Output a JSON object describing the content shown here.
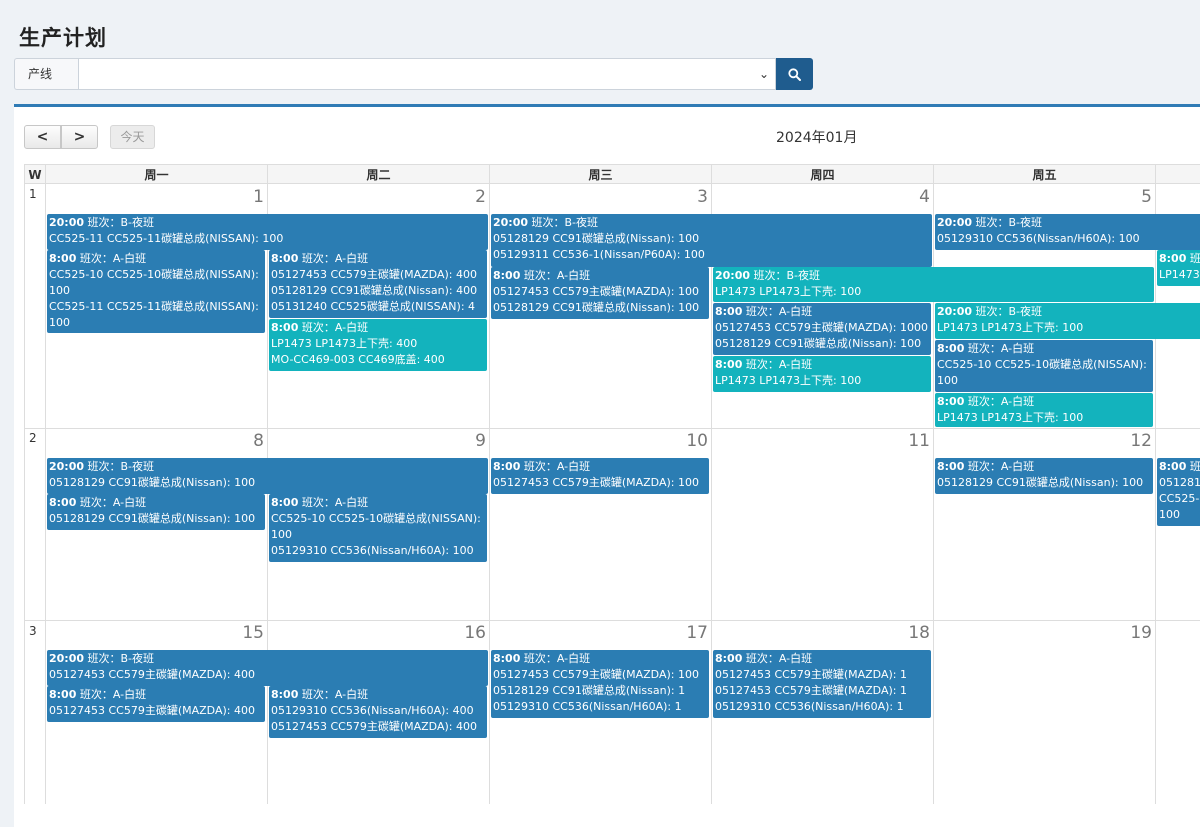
{
  "page": {
    "title": "生产计划"
  },
  "filter": {
    "label": "产线",
    "value": ""
  },
  "toolbar": {
    "prev": "<",
    "next": ">",
    "today": "今天",
    "month": "2024年01月"
  },
  "weekdays": [
    "W",
    "周一",
    "周二",
    "周三",
    "周四",
    "周五"
  ],
  "weeks": [
    {
      "week": "1",
      "days": [
        "1",
        "2",
        "3",
        "4",
        "5"
      ]
    },
    {
      "week": "2",
      "days": [
        "8",
        "9",
        "10",
        "11",
        "12"
      ]
    },
    {
      "week": "3",
      "days": [
        "15",
        "16",
        "17",
        "18",
        "19"
      ]
    }
  ],
  "events": [
    {
      "time": "20:00",
      "shift": " 班次：B-夜班",
      "color": "blue",
      "lines": [
        "CC525-11 CC525-11碳罐总成(NISSAN): 100"
      ]
    },
    {
      "time": "20:00",
      "shift": " 班次：B-夜班",
      "color": "blue",
      "lines": [
        "05128129 CC91碳罐总成(Nissan): 100",
        "05129311 CC536-1(Nissan/P60A): 100"
      ]
    },
    {
      "time": "20:00",
      "shift": " 班次：B-夜班",
      "color": "blue",
      "lines": [
        "05129310 CC536(Nissan/H60A): 100"
      ]
    },
    {
      "time": "8:00",
      "shift": " 班次：A-白班",
      "color": "blue",
      "lines": [
        "CC525-10 CC525-10碳罐总成(NISSAN):",
        "100",
        "CC525-11 CC525-11碳罐总成(NISSAN):",
        "100"
      ]
    },
    {
      "time": "8:00",
      "shift": " 班次：A-白班",
      "color": "blue",
      "lines": [
        "05127453 CC579主碳罐(MAZDA): 400",
        "05128129 CC91碳罐总成(Nissan): 400",
        "05131240 CC525碳罐总成(NISSAN): 4"
      ]
    },
    {
      "time": "8:00",
      "shift": " 班次：A-白班",
      "color": "blue",
      "lines": [
        "05127453 CC579主碳罐(MAZDA): 100",
        "05128129 CC91碳罐总成(Nissan): 100"
      ]
    },
    {
      "time": "20:00",
      "shift": " 班次：B-夜班",
      "color": "teal",
      "lines": [
        "LP1473 LP1473上下壳: 100"
      ]
    },
    {
      "time": "8:00",
      "shift": " 班次",
      "color": "teal",
      "lines": [
        "LP1473"
      ]
    },
    {
      "time": "8:00",
      "shift": " 班次：A-白班",
      "color": "teal",
      "lines": [
        "LP1473 LP1473上下壳: 400",
        "MO-CC469-003 CC469底盖: 400"
      ]
    },
    {
      "time": "8:00",
      "shift": " 班次：A-白班",
      "color": "blue",
      "lines": [
        "05127453 CC579主碳罐(MAZDA): 1000",
        "05128129 CC91碳罐总成(Nissan): 100"
      ]
    },
    {
      "time": "20:00",
      "shift": " 班次：B-夜班",
      "color": "teal",
      "lines": [
        "LP1473 LP1473上下壳: 100"
      ]
    },
    {
      "time": "8:00",
      "shift": " 班次：A-白班",
      "color": "blue",
      "lines": [
        "CC525-10 CC525-10碳罐总成(NISSAN):",
        "100"
      ]
    },
    {
      "time": "8:00",
      "shift": " 班次：A-白班",
      "color": "teal",
      "lines": [
        "LP1473 LP1473上下壳: 100"
      ]
    },
    {
      "time": "8:00",
      "shift": " 班次：A-白班",
      "color": "teal",
      "lines": [
        "LP1473 LP1473上下壳: 100"
      ]
    },
    {
      "time": "20:00",
      "shift": " 班次：B-夜班",
      "color": "blue",
      "lines": [
        "05128129 CC91碳罐总成(Nissan): 100"
      ]
    },
    {
      "time": "8:00",
      "shift": " 班次：A-白班",
      "color": "blue",
      "lines": [
        "05127453 CC579主碳罐(MAZDA): 100"
      ]
    },
    {
      "time": "8:00",
      "shift": " 班次：A-白班",
      "color": "blue",
      "lines": [
        "05128129 CC91碳罐总成(Nissan): 100"
      ]
    },
    {
      "time": "8:00",
      "shift": " 班次",
      "color": "blue",
      "lines": [
        "051281",
        "CC525-",
        "100"
      ]
    },
    {
      "time": "8:00",
      "shift": " 班次：A-白班",
      "color": "blue",
      "lines": [
        "05128129 CC91碳罐总成(Nissan): 100"
      ]
    },
    {
      "time": "8:00",
      "shift": " 班次：A-白班",
      "color": "blue",
      "lines": [
        "CC525-10 CC525-10碳罐总成(NISSAN):",
        "100",
        "05129310 CC536(Nissan/H60A): 100"
      ]
    },
    {
      "time": "20:00",
      "shift": " 班次：B-夜班",
      "color": "blue",
      "lines": [
        "05127453 CC579主碳罐(MAZDA): 400"
      ]
    },
    {
      "time": "8:00",
      "shift": " 班次：A-白班",
      "color": "blue",
      "lines": [
        "05127453 CC579主碳罐(MAZDA): 100",
        "05128129 CC91碳罐总成(Nissan): 1",
        "05129310 CC536(Nissan/H60A): 1"
      ]
    },
    {
      "time": "8:00",
      "shift": " 班次：A-白班",
      "color": "blue",
      "lines": [
        "05127453 CC579主碳罐(MAZDA): 1",
        "05127453 CC579主碳罐(MAZDA): 1",
        "05129310 CC536(Nissan/H60A): 1"
      ]
    },
    {
      "time": "8:00",
      "shift": " 班次：A-白班",
      "color": "blue",
      "lines": [
        "05127453 CC579主碳罐(MAZDA): 400"
      ]
    },
    {
      "time": "8:00",
      "shift": " 班次：A-白班",
      "color": "blue",
      "lines": [
        "05129310 CC536(Nissan/H60A): 400",
        "05127453 CC579主碳罐(MAZDA): 400"
      ]
    }
  ]
}
